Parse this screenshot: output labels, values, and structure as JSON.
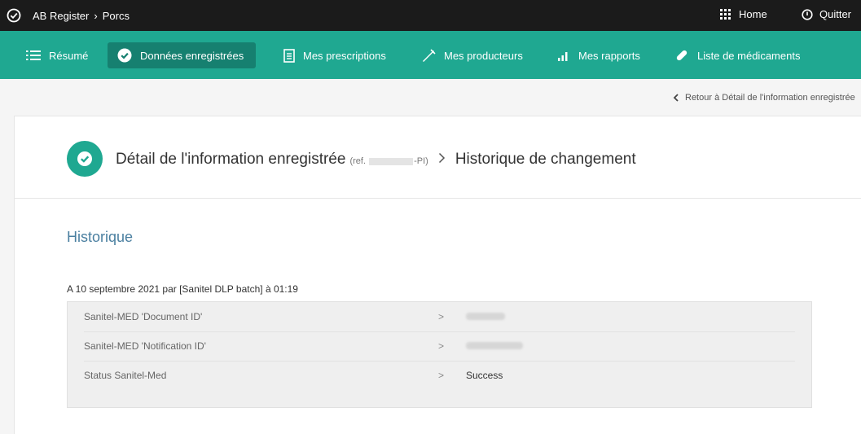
{
  "topbar": {
    "app": "AB Register",
    "section": "Porcs",
    "home_label": "Home",
    "quit_label": "Quitter"
  },
  "nav": {
    "items": [
      {
        "label": "Résumé",
        "icon": "list-icon"
      },
      {
        "label": "Données enregistrées",
        "icon": "check-circle-icon",
        "active": true
      },
      {
        "label": "Mes prescriptions",
        "icon": "document-icon"
      },
      {
        "label": "Mes producteurs",
        "icon": "syringe-icon"
      },
      {
        "label": "Mes rapports",
        "icon": "bar-chart-icon"
      },
      {
        "label": "Liste de médicaments",
        "icon": "pill-icon"
      }
    ]
  },
  "back_link": "Retour à Détail de l'information enregistrée",
  "header": {
    "title": "Détail de l'information enregistrée",
    "ref_prefix": "(ref.",
    "ref_suffix": "-PI)",
    "subtitle": "Historique de changement"
  },
  "history": {
    "section_title": "Historique",
    "entry": {
      "meta": "A 10 septembre 2021 par [Sanitel DLP batch] à 01:19",
      "changes": [
        {
          "field": "Sanitel-MED 'Document ID'",
          "arrow": ">",
          "value": ""
        },
        {
          "field": "Sanitel-MED 'Notification ID'",
          "arrow": ">",
          "value": ""
        },
        {
          "field": "Status Sanitel-Med",
          "arrow": ">",
          "value": "Success"
        }
      ]
    }
  },
  "colors": {
    "brand": "#1fa891",
    "brand_dark": "#168070",
    "topbar": "#1b1b1b",
    "section_title": "#4a7fa0"
  }
}
